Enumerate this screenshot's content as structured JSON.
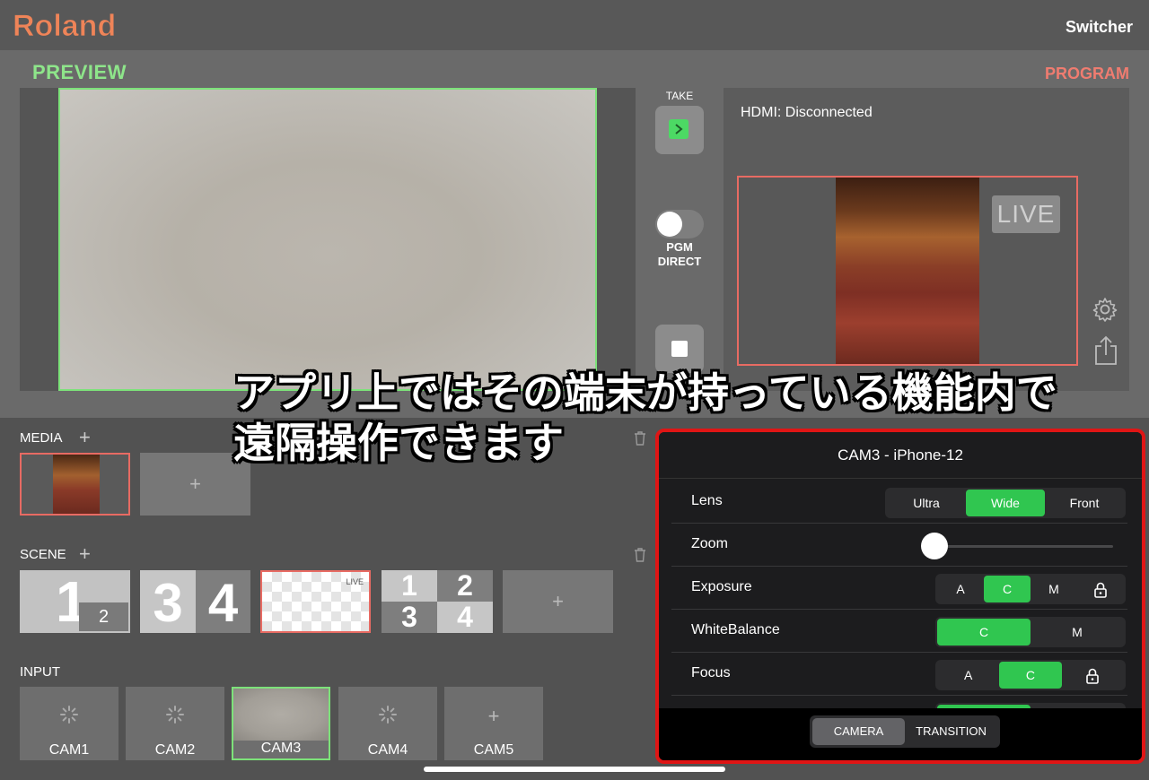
{
  "header": {
    "logo_text": "Roland",
    "title": "Switcher",
    "logo_color": "#ef8458"
  },
  "preview": {
    "label": "PREVIEW",
    "label_color": "#8ee58a"
  },
  "controls": {
    "take_label": "TAKE",
    "pgm_direct_label_line1": "PGM",
    "pgm_direct_label_line2": "DIRECT",
    "pgm_direct_on": false
  },
  "program": {
    "label": "PROGRAM",
    "label_color": "#ef7c70",
    "hdmi_status": "HDMI:  Disconnected",
    "live_badge": "LIVE"
  },
  "media": {
    "label": "MEDIA"
  },
  "scene": {
    "label": "SCENE",
    "items": [
      {
        "main": "1",
        "sub": "2"
      },
      {
        "left": "3",
        "right": "4"
      },
      {
        "badge": "LIVE"
      },
      {
        "q1": "1",
        "q2": "2",
        "q3": "3",
        "q4": "4"
      }
    ]
  },
  "input": {
    "label": "INPUT",
    "cams": [
      "CAM1",
      "CAM2",
      "CAM3",
      "CAM4",
      "CAM5"
    ],
    "active_cam": "CAM3"
  },
  "caption": {
    "line1": "アプリ上ではその端末が持っている機能内で",
    "line2": "遠隔操作できます"
  },
  "camera_panel": {
    "title": "CAM3 - iPhone-12",
    "accent_color": "#30c650",
    "lens": {
      "label": "Lens",
      "options": [
        "Ultra",
        "Wide",
        "Front"
      ],
      "selected": "Wide"
    },
    "zoom": {
      "label": "Zoom",
      "value": 0
    },
    "exposure": {
      "label": "Exposure",
      "options": [
        "A",
        "C",
        "M"
      ],
      "selected": "C"
    },
    "white_balance": {
      "label": "WhiteBalance",
      "options": [
        "C",
        "M"
      ],
      "selected": "C"
    },
    "focus": {
      "label": "Focus",
      "options": [
        "A",
        "C"
      ],
      "selected": "C"
    },
    "tabs": [
      "CAMERA",
      "TRANSITION"
    ],
    "active_tab": "CAMERA"
  }
}
